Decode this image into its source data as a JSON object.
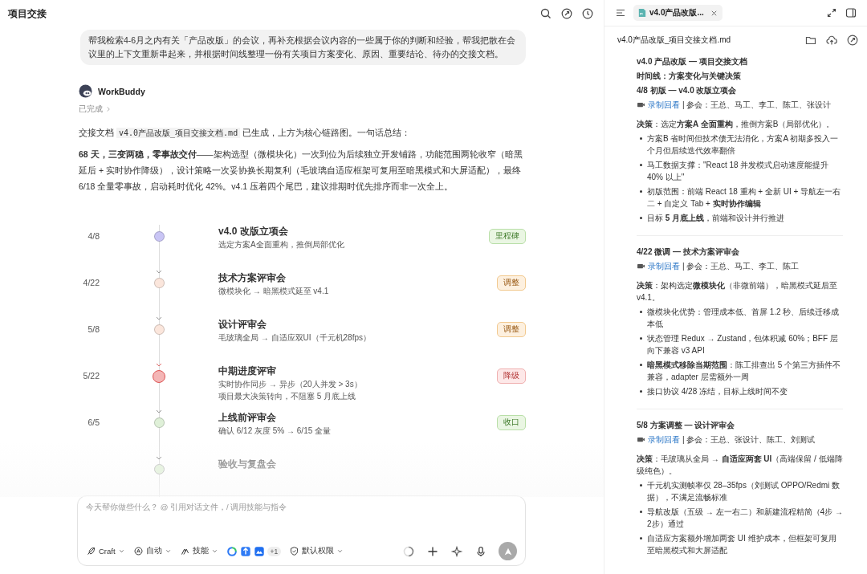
{
  "header": {
    "title": "项目交接"
  },
  "chat": {
    "user_message": "帮我检索4-6月之内有关「产品改版」的会议，再补充根据会议内容的一些属于你的判断和经验，帮我把散在会议里的上下文重新串起来，并根据时间线整理一份有关项目方案变化、原因、重要结论、待办的交接文档。",
    "assistant": {
      "name": "WorkBuddy",
      "status": "已完成",
      "intro_before": "交接文档",
      "file_name": "v4.0产品改版_项目交接文档.md",
      "intro_after": "已生成，上方为核心链路图。一句话总结：",
      "summary": "**68 天，三变两稳，零事故交付**——架构选型（微模块化）一次到位为后续独立开发铺路，功能范围两轮收窄（暗黑延后 + 实时协作降级），设计策略一次妥协换长期复利（毛玻璃自适应框架可复用至暗黑模式和大屏适配），最终 6/18 全量零事故，启动耗时优化 42%。v4.1 压着四个尾巴，建议排期时优先排序而非一次全上。"
    }
  },
  "timeline": [
    {
      "date": "4/8",
      "title": "v4.0 改版立项会",
      "lines": [
        "选定方案A全面重构，推倒局部优化"
      ],
      "color": "#c9c5f5",
      "emphasized": false,
      "faded": false,
      "tag": {
        "text": "里程碑",
        "kind": "green"
      }
    },
    {
      "date": "4/22",
      "title": "技术方案评审会",
      "lines": [
        "微模块化 → 暗黑模式延至 v4.1"
      ],
      "color": "#fbe6dc",
      "emphasized": false,
      "faded": false,
      "tag": {
        "text": "调整",
        "kind": "orange"
      }
    },
    {
      "date": "5/8",
      "title": "设计评审会",
      "lines": [
        "毛玻璃全局 → 自适应双UI（千元机28fps）"
      ],
      "color": "#fbe6dc",
      "emphasized": false,
      "faded": false,
      "tag": {
        "text": "调整",
        "kind": "orange"
      }
    },
    {
      "date": "5/22",
      "title": "中期进度评审",
      "lines": [
        "实时协作同步 → 异步（20人并发 > 3s）",
        "项目最大决策转向，不阻塞 5 月底上线"
      ],
      "color": "#f4b6b6",
      "emphasized": true,
      "faded": false,
      "tag": {
        "text": "降级",
        "kind": "red"
      }
    },
    {
      "date": "6/5",
      "title": "上线前评审会",
      "lines": [
        "确认 6/12 灰度 5% → 6/15 全量"
      ],
      "color": "#dff0d8",
      "emphasized": false,
      "faded": false,
      "tag": {
        "text": "收口",
        "kind": "green"
      }
    },
    {
      "title": "验收与复盘会",
      "color": "#e8f3e2",
      "emphasized": false,
      "faded": true
    }
  ],
  "composer": {
    "placeholder": "今天帮你做些什么？ @ 引用对话文件，/ 调用技能与指令",
    "mode": "Craft",
    "auto": "自动",
    "skills": "技能",
    "extra_count": "+1",
    "permission": "默认权限"
  },
  "doc_panel": {
    "tab": "v4.0产品改版...",
    "file_name": "v4.0产品改版_项目交接文档.md",
    "title": "v4.0 产品改版 — 项目交接文档",
    "subtitle": "时间线：方案变化与关键决策",
    "sections": [
      {
        "heading": "4/8 初版 — v4.0 改版立项会",
        "link": "录制回看",
        "attendees": "| 参会：王总、马工、李工、陈工、张设计",
        "decision": "**决策**：选定**方案A 全面重构**，推倒方案B（局部优化）。",
        "bullets": [
          "方案B 省时间但技术债无法消化，方案A 初期多投入一个月但后续迭代效率翻倍",
          "马工数据支撑：\"React 18 并发模式启动速度能提升 40% 以上\"",
          "初版范围：前端 React 18 重构 + 全新 UI + 导航左一右二 + 自定义 Tab + **实时协作编辑**",
          "目标 **5 月底上线**，前端和设计并行推进"
        ]
      },
      {
        "heading": "4/22 微调 — 技术方案评审会",
        "link": "录制回看",
        "attendees": "| 参会：王总、马工、李工、陈工",
        "decision": "**决策**：架构选定**微模块化**（非微前端），暗黑模式延后至 v4.1。",
        "bullets": [
          "微模块化优势：管理成本低、首屏 1.2 秒、后续迁移成本低",
          "状态管理 Redux → Zustand，包体积减 60%；BFF 层向下兼容 v3 API",
          "**暗黑模式移除当期范围**：陈工排查出 5 个第三方插件不兼容，adapter 层需额外一周",
          "接口协议 4/28 冻结，目标上线时间不变"
        ]
      },
      {
        "heading": "5/8 方案调整 — 设计评审会",
        "link": "录制回看",
        "attendees": "| 参会：王总、张设计、陈工、刘测试",
        "decision": "**决策**：毛玻璃从全局 → **自适应两套 UI**（高端保留 / 低端降级纯色）。",
        "bullets": [
          "千元机实测帧率仅 28–35fps（刘测试 OPPO/Redmi 数据），不满足流畅标准",
          "导航改版（五级 → 左一右二）和新建流程精简（4步 → 2步）通过",
          "自适应方案额外增加两套 UI 维护成本，但框架可复用至暗黑模式和大屏适配"
        ]
      }
    ]
  }
}
